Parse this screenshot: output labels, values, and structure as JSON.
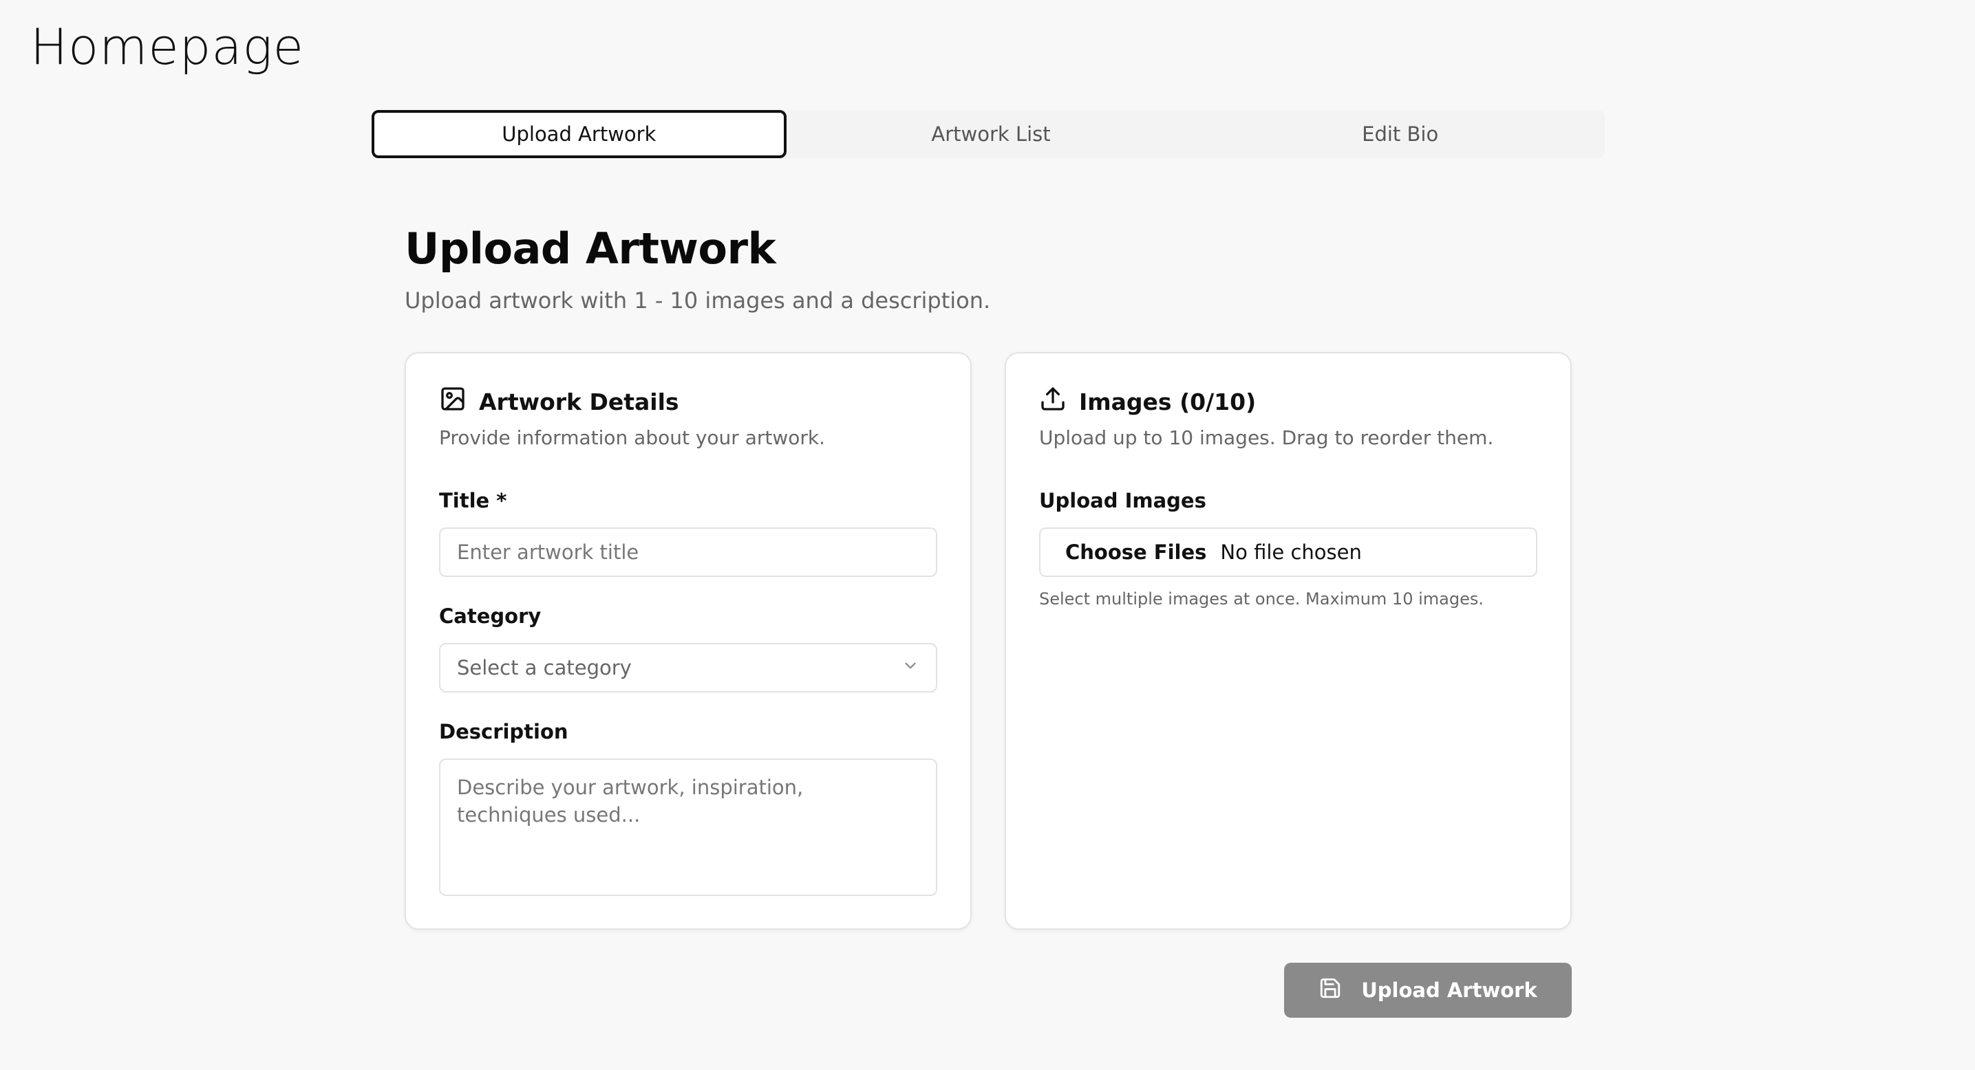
{
  "page": {
    "title": "Homepage"
  },
  "tabs": [
    {
      "label": "Upload Artwork",
      "active": true
    },
    {
      "label": "Artwork List",
      "active": false
    },
    {
      "label": "Edit Bio",
      "active": false
    }
  ],
  "section": {
    "title": "Upload Artwork",
    "subtitle": "Upload artwork with 1 - 10 images and a description."
  },
  "details_card": {
    "icon": "image-icon",
    "title": "Artwork Details",
    "description": "Provide information about your artwork.",
    "title_field": {
      "label": "Title *",
      "placeholder": "Enter artwork title",
      "value": ""
    },
    "category_field": {
      "label": "Category",
      "placeholder": "Select a category"
    },
    "description_field": {
      "label": "Description",
      "placeholder": "Describe your artwork, inspiration, techniques used..."
    }
  },
  "images_card": {
    "icon": "upload-icon",
    "title": "Images (0/10)",
    "description": "Upload up to 10 images. Drag to reorder them.",
    "upload_field": {
      "label": "Upload Images",
      "button_label": "Choose Files",
      "status": "No file chosen",
      "hint": "Select multiple images at once. Maximum 10 images."
    }
  },
  "submit": {
    "icon": "save-icon",
    "label": "Upload Artwork",
    "disabled": true
  },
  "colors": {
    "accent": "#111111",
    "disabled_button": "#8a8a8a",
    "background": "#f8f8f8"
  }
}
